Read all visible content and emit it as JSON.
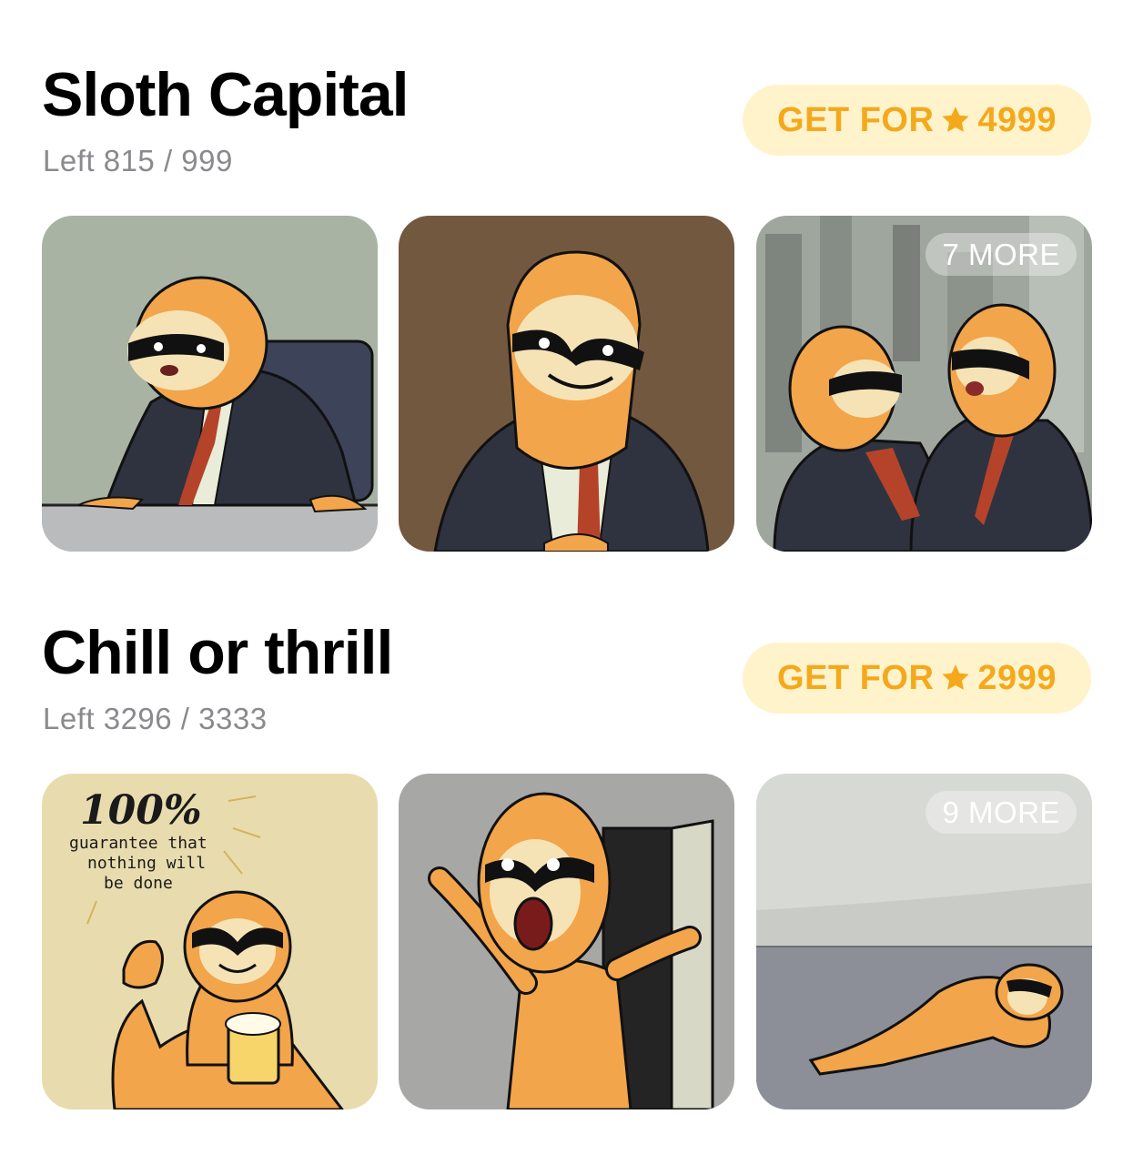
{
  "packs": [
    {
      "title": "Sloth Capital",
      "left_label": "Left 815 / 999",
      "button_text": "GET FOR",
      "price": "4999",
      "more_label": "7 MORE",
      "stickers": [
        "sloth-at-desk",
        "sloth-smiling-in-suit",
        "two-sloths-laughing"
      ]
    },
    {
      "title": "Chill or thrill",
      "left_label": "Left 3296 / 3333",
      "button_text": "GET FOR",
      "price": "2999",
      "more_label": "9 MORE",
      "sticker_caption": {
        "big": "100%",
        "line1": "guarantee that",
        "line2": "nothing will",
        "line3": "be done"
      },
      "stickers": [
        "sloth-ok-with-beer",
        "sloth-shocked-at-door",
        "sloth-crawling-on-floor"
      ]
    }
  ],
  "colors": {
    "accent": "#f4a91c",
    "button_bg": "#fff3cc",
    "muted_text": "#8a8a8e",
    "sloth_orange": "#f2a54a",
    "suit": "#2f3340"
  },
  "icons": {
    "price": "star-icon"
  }
}
